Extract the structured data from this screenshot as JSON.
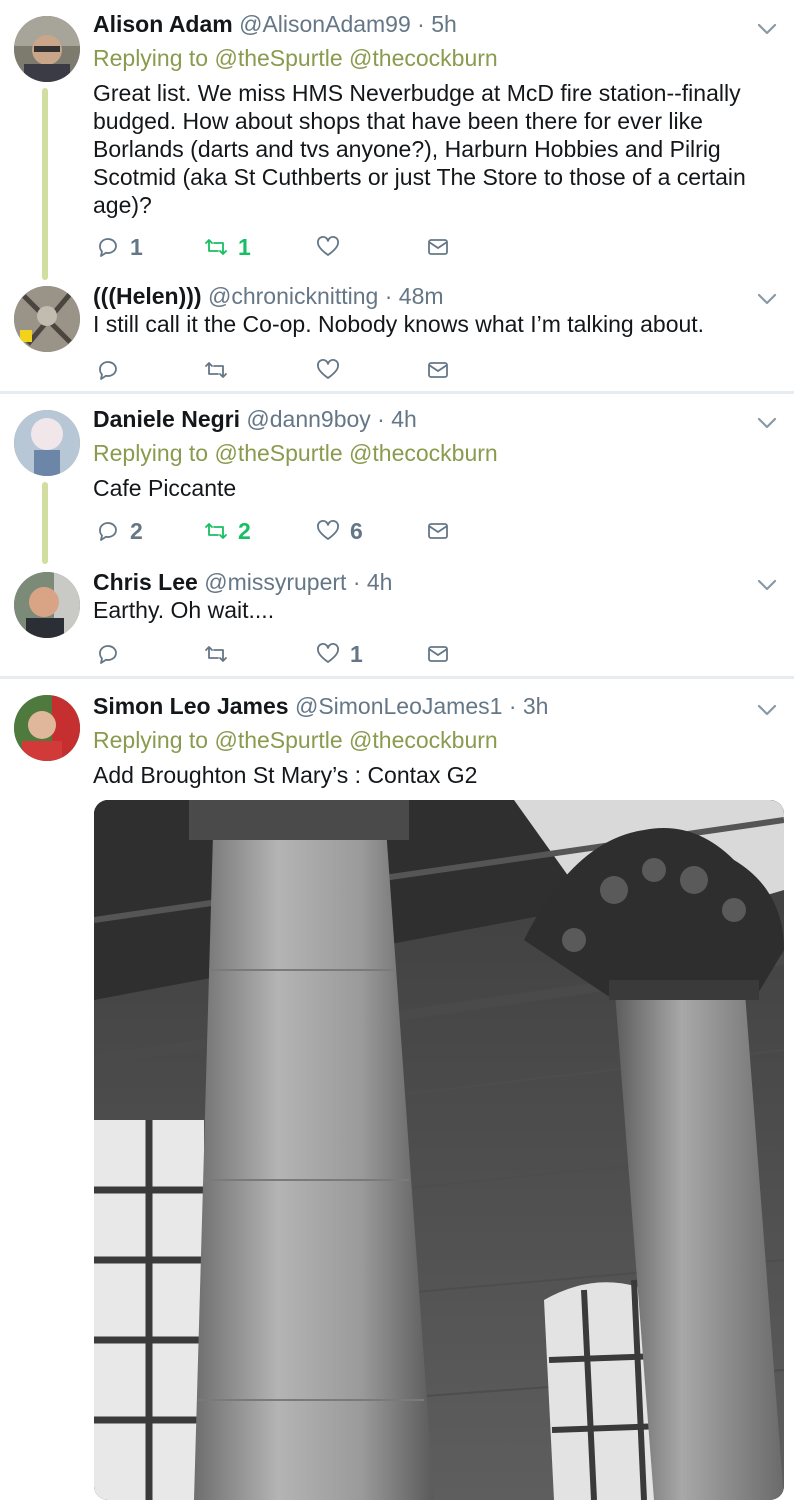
{
  "tweets": [
    {
      "name": "Alison Adam",
      "handle": "@AlisonAdam99",
      "time": "· 5h",
      "replying_label": "Replying to",
      "replying_to": "@theSpurtle @thecockburn",
      "text": "Great list. We miss HMS Neverbudge at McD fire station--finally budged. How about shops that have been there for ever like Borlands (darts and tvs anyone?), Harburn Hobbies and Pilrig Scotmid (aka St Cuthberts or just The Store to those of a certain age)?",
      "replies": "1",
      "retweets": "1",
      "likes": ""
    },
    {
      "name": "(((Helen)))",
      "handle": "@chronicknitting",
      "time": "· 48m",
      "text": "I still call it the Co-op. Nobody knows what I’m talking about.",
      "replies": "",
      "retweets": "",
      "likes": ""
    },
    {
      "name": "Daniele Negri",
      "handle": "@dann9boy",
      "time": "· 4h",
      "replying_label": "Replying to",
      "replying_to": "@theSpurtle @thecockburn",
      "text": "Cafe Piccante",
      "replies": "2",
      "retweets": "2",
      "likes": "6"
    },
    {
      "name": "Chris Lee",
      "handle": "@missyrupert",
      "time": "· 4h",
      "text": "Earthy. Oh wait....",
      "replies": "",
      "retweets": "",
      "likes": "1"
    },
    {
      "name": "Simon Leo James",
      "handle": "@SimonLeoJames1",
      "time": "· 3h",
      "replying_label": "Replying to",
      "replying_to": "@theSpurtle @thecockburn",
      "text": "Add Broughton St Mary’s : Contax G2"
    }
  ],
  "colors": {
    "reply_link": "#8a9a4e",
    "retweet_active": "#17bf63",
    "thread_line": "#d2dda0",
    "icon_gray": "#657786"
  },
  "icons": [
    "reply-icon",
    "retweet-icon",
    "like-icon",
    "message-icon",
    "chevron-down-icon"
  ]
}
